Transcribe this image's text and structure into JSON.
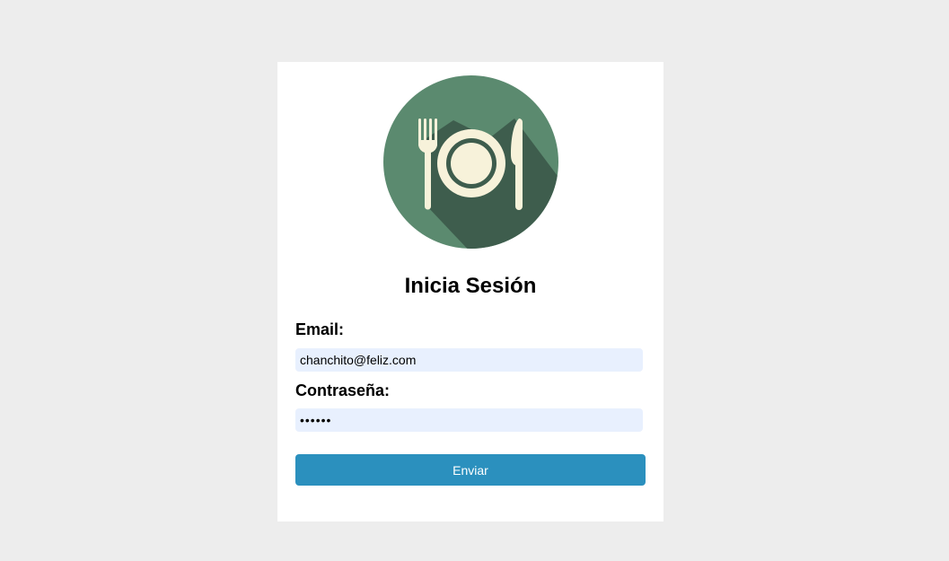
{
  "logo": {
    "icon": "plate-fork-knife-icon",
    "bg_color": "#5b8a6f",
    "shadow_color": "#3e5d4d",
    "fg_color": "#f7f2da"
  },
  "form": {
    "title": "Inicia Sesión",
    "email_label": "Email:",
    "email_value": "chanchito@feliz.com",
    "password_label": "Contraseña:",
    "password_value": "secret",
    "submit_label": "Enviar"
  },
  "colors": {
    "page_bg": "#ededed",
    "card_bg": "#ffffff",
    "input_bg": "#e8f0fe",
    "button_bg": "#2b90be"
  }
}
